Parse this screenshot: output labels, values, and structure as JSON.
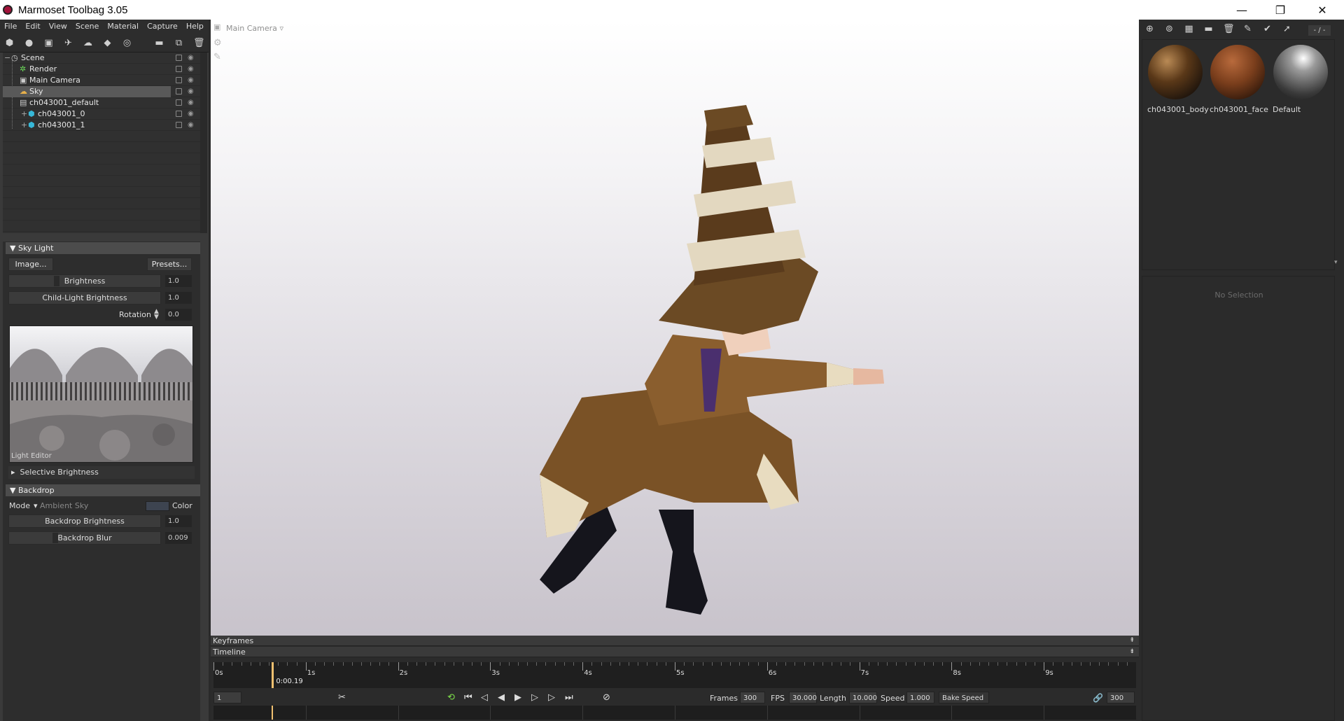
{
  "window": {
    "title": "Marmoset Toolbag 3.05",
    "minimize": "—",
    "maximize": "❐",
    "close": "✕"
  },
  "menu": [
    "File",
    "Edit",
    "View",
    "Scene",
    "Material",
    "Capture",
    "Help"
  ],
  "tree": {
    "items": [
      {
        "label": "Scene",
        "indent": 0
      },
      {
        "label": "Render",
        "indent": 1
      },
      {
        "label": "Main Camera",
        "indent": 1
      },
      {
        "label": "Sky",
        "indent": 1,
        "selected": true
      },
      {
        "label": "ch043001_default",
        "indent": 1
      },
      {
        "label": "ch043001_0",
        "indent": 2
      },
      {
        "label": "ch043001_1",
        "indent": 2
      }
    ]
  },
  "skylight": {
    "header": "Sky Light",
    "image_btn": "Image...",
    "presets_btn": "Presets...",
    "brightness_label": "Brightness",
    "brightness_val": "1.0",
    "child_label": "Child-Light Brightness",
    "child_val": "1.0",
    "rotation_label": "Rotation",
    "rotation_val": "0.0",
    "editor_label": "Light Editor",
    "selective": "Selective Brightness"
  },
  "backdrop": {
    "header": "Backdrop",
    "mode_label": "Mode",
    "mode_value": "Ambient Sky",
    "color_label": "Color",
    "brightness_label": "Backdrop Brightness",
    "brightness_val": "1.0",
    "blur_label": "Backdrop Blur",
    "blur_val": "0.009"
  },
  "viewport": {
    "camera": "Main Camera"
  },
  "materials": {
    "path": "- / -",
    "items": [
      {
        "label": "ch043001_body",
        "color": "#3a2414"
      },
      {
        "label": "ch043001_face",
        "color": "#6b3a20"
      },
      {
        "label": "Default",
        "color": "#8a8a8a"
      }
    ],
    "no_selection": "No Selection"
  },
  "timeline": {
    "keyframes_label": "Keyframes",
    "timeline_label": "Timeline",
    "ticks": [
      "0s",
      "1s",
      "2s",
      "3s",
      "4s",
      "5s",
      "6s",
      "7s",
      "8s",
      "9s"
    ],
    "current_time": "0:00.19",
    "playhead_fraction": 0.0633,
    "start_frame": "1",
    "frames_label": "Frames",
    "frames_val": "300",
    "fps_label": "FPS",
    "fps_val": "30.000",
    "length_label": "Length",
    "length_val": "10.000",
    "speed_label": "Speed",
    "speed_val": "1.000",
    "bake_speed": "Bake Speed",
    "end_frame": "300"
  }
}
